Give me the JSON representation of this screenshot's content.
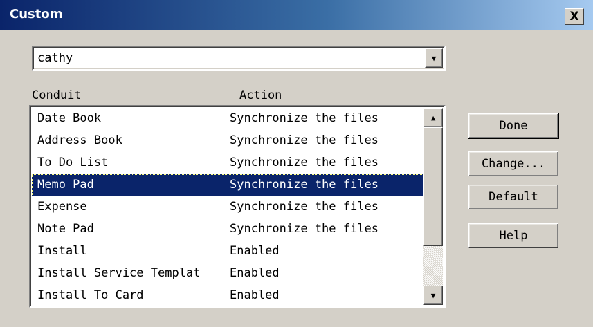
{
  "window": {
    "title": "Custom",
    "close_label": "X"
  },
  "user_combo": {
    "value": "cathy",
    "arrow_icon": "▼"
  },
  "list": {
    "headers": {
      "conduit": "Conduit",
      "action": "Action"
    },
    "rows": [
      {
        "conduit": "Date Book",
        "action": "Synchronize the files"
      },
      {
        "conduit": "Address Book",
        "action": "Synchronize the files"
      },
      {
        "conduit": "To Do List",
        "action": "Synchronize the files"
      },
      {
        "conduit": "Memo Pad",
        "action": "Synchronize the files",
        "selected": true
      },
      {
        "conduit": "Expense",
        "action": "Synchronize the files"
      },
      {
        "conduit": "Note Pad",
        "action": "Synchronize the files"
      },
      {
        "conduit": "Install",
        "action": "Enabled"
      },
      {
        "conduit": "Install Service Templat",
        "action": "Enabled"
      },
      {
        "conduit": "Install To Card",
        "action": "Enabled"
      }
    ],
    "scroll_up_icon": "▲",
    "scroll_down_icon": "▼"
  },
  "buttons": {
    "done": "Done",
    "change": "Change...",
    "default": "Default",
    "help": "Help"
  },
  "colors": {
    "title_gradient_start": "#0a246a",
    "selection": "#0a246a",
    "face": "#d4d0c8"
  }
}
